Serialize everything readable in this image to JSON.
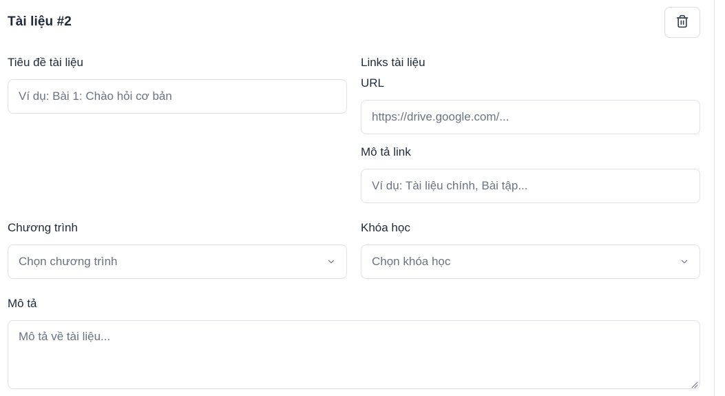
{
  "header": {
    "title": "Tài liệu #2",
    "delete_icon": "trash-icon"
  },
  "fields": {
    "doc_title": {
      "label": "Tiêu đề tài liệu",
      "placeholder": "Ví dụ: Bài 1: Chào hỏi cơ bản",
      "value": ""
    },
    "links": {
      "section_label": "Links tài liệu",
      "url": {
        "label": "URL",
        "placeholder": "https://drive.google.com/...",
        "value": ""
      },
      "link_description": {
        "label": "Mô tả link",
        "placeholder": "Ví dụ: Tài liệu chính, Bài tập...",
        "value": ""
      }
    },
    "program": {
      "label": "Chương trình",
      "selected": "Chọn chương trình",
      "icon": "chevron-down-icon"
    },
    "course": {
      "label": "Khóa học",
      "selected": "Chọn khóa học",
      "icon": "chevron-down-icon"
    },
    "description": {
      "label": "Mô tả",
      "placeholder": "Mô tả về tài liệu...",
      "value": ""
    }
  },
  "colors": {
    "border": "#dde1e6",
    "text": "#1f2937",
    "placeholder": "#6b7280",
    "icon": "#374151"
  }
}
